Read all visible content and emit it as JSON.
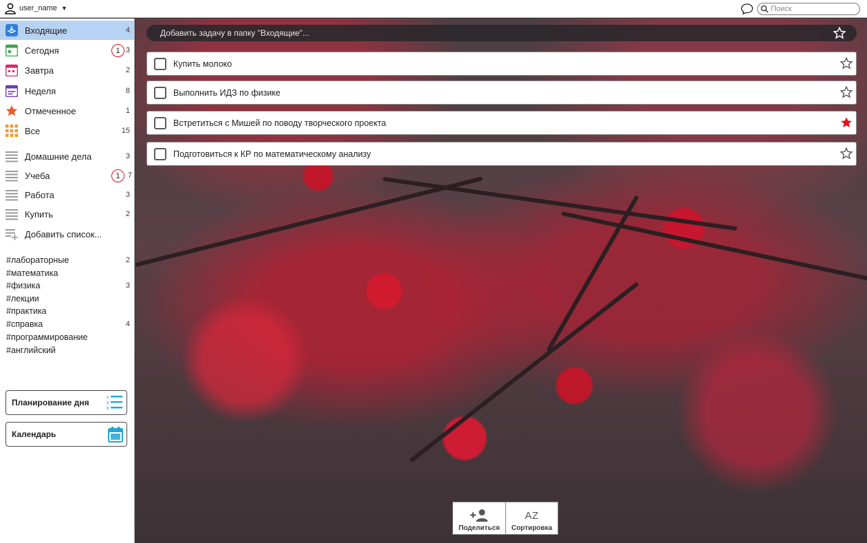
{
  "header": {
    "user_name": "user_name",
    "search_placeholder": "Поиск"
  },
  "sidebar": {
    "folders": [
      {
        "label": "Входящие",
        "count": "4",
        "badge": "",
        "icon": "inbox-icon",
        "color": "#2f7fd8"
      },
      {
        "label": "Сегодня",
        "count": "3",
        "badge": "1",
        "icon": "calendar-today-icon",
        "color": "#3aa64a"
      },
      {
        "label": "Завтра",
        "count": "2",
        "badge": "",
        "icon": "calendar-tomorrow-icon",
        "color": "#d52a6a"
      },
      {
        "label": "Неделя",
        "count": "8",
        "badge": "",
        "icon": "calendar-week-icon",
        "color": "#6a3bb0"
      },
      {
        "label": "Отмеченное",
        "count": "1",
        "badge": "",
        "icon": "star-icon",
        "color": "#ef5a28"
      },
      {
        "label": "Все",
        "count": "15",
        "badge": "",
        "icon": "grid-icon",
        "color": "#f29a2e"
      }
    ],
    "lists": [
      {
        "label": "Домашние дела",
        "count": "3",
        "badge": ""
      },
      {
        "label": "Учеба",
        "count": "7",
        "badge": "1"
      },
      {
        "label": "Работа",
        "count": "3",
        "badge": ""
      },
      {
        "label": "Купить",
        "count": "2",
        "badge": ""
      }
    ],
    "add_list_label": "Добавить список...",
    "tags": [
      {
        "label": "#лабораторные",
        "count": "2"
      },
      {
        "label": "#математика",
        "count": ""
      },
      {
        "label": "#физика",
        "count": "3"
      },
      {
        "label": "#лекции",
        "count": ""
      },
      {
        "label": "#практика",
        "count": ""
      },
      {
        "label": "#справка",
        "count": "4"
      },
      {
        "label": "#программирование",
        "count": ""
      },
      {
        "label": "#английский",
        "count": ""
      }
    ],
    "day_planning_label": "Планирование дня",
    "calendar_label": "Календарь",
    "accent_color": "#1fa8d8"
  },
  "main": {
    "add_task_placeholder": "Добавить задачу в папку \"Входящие\"...",
    "tasks": [
      {
        "title": "Купить молоко",
        "starred": false
      },
      {
        "title": "Выполнить ИДЗ по физике",
        "starred": false
      },
      {
        "title": "Встретиться с Мишей по поводу творческого проекта",
        "starred": true
      },
      {
        "title": "Подготовиться к КР по математическому анализу",
        "starred": false
      }
    ],
    "star_color": "#e3121e"
  },
  "bottom_toolbar": {
    "share_label": "Поделиться",
    "sort_label": "Сортировка",
    "sort_icon_text": "AZ"
  }
}
